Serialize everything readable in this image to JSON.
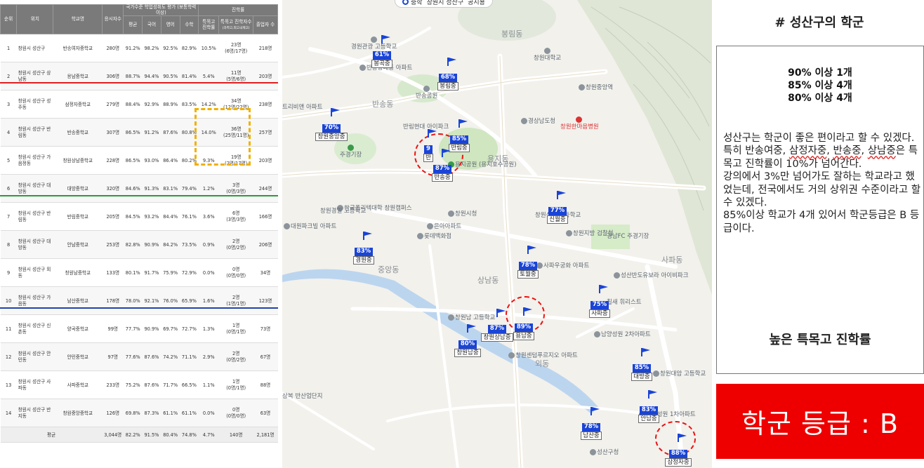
{
  "table": {
    "headers": {
      "rank": "순위",
      "region": "위치",
      "school": "학교명",
      "applicants": "응시자수",
      "achievement_group": "국가수준 학업성취도 평가 (보통학력이상)",
      "avg": "평균",
      "korean": "국어",
      "english": "영어",
      "math": "수학",
      "progress_group": "진학률",
      "special_rate": "특목고 진학률",
      "special_count": "특목고 진학자수",
      "special_count_sub": "(과학고,외고국제고)",
      "graduates": "졸업자 수"
    },
    "rows": [
      {
        "rank": "1",
        "region": "창원시 성산구",
        "school": "반송여자중학교",
        "applicants": "280명",
        "avg": "91.2%",
        "korean": "98.2%",
        "english": "92.5%",
        "math": "82.9%",
        "special_rate": "10.5%",
        "special_count": "23명\n(6명/17명)",
        "graduates": "218명"
      },
      {
        "rank": "2",
        "region": "창원시 성산구 상남동",
        "school": "용남중학교",
        "applicants": "306명",
        "avg": "88.7%",
        "korean": "94.4%",
        "english": "90.5%",
        "math": "81.4%",
        "special_rate": "5.4%",
        "special_count": "11명\n(5명/6명)",
        "graduates": "203명"
      },
      {
        "rank": "3",
        "region": "창원시 성산구 성주동",
        "school": "삼정자중학교",
        "applicants": "279명",
        "avg": "88.4%",
        "korean": "92.9%",
        "english": "88.9%",
        "math": "83.5%",
        "special_rate": "14.2%",
        "special_count": "34명\n(12명/22명)",
        "graduates": "238명"
      },
      {
        "rank": "4",
        "region": "창원시 성산구 반림동",
        "school": "반송중학교",
        "applicants": "307명",
        "avg": "86.5%",
        "korean": "91.2%",
        "english": "87.6%",
        "math": "80.8%",
        "special_rate": "14.0%",
        "special_count": "36명\n(25명/11명)",
        "graduates": "257명"
      },
      {
        "rank": "5",
        "region": "창원시 성산구 가음정동",
        "school": "창원상남중학교",
        "applicants": "228명",
        "avg": "86.5%",
        "korean": "93.0%",
        "english": "86.4%",
        "math": "80.2%",
        "special_rate": "9.3%",
        "special_count": "19명\n(2명/17명)",
        "graduates": "203명"
      },
      {
        "rank": "6",
        "region": "창원시 성산구 대방동",
        "school": "대방중학교",
        "applicants": "320명",
        "avg": "84.6%",
        "korean": "91.3%",
        "english": "83.1%",
        "math": "79.4%",
        "special_rate": "1.2%",
        "special_count": "3명\n(0명/3명)",
        "graduates": "244명"
      },
      {
        "rank": "7",
        "region": "창원시 성산구 반림동",
        "school": "반림중학교",
        "applicants": "205명",
        "avg": "84.5%",
        "korean": "93.2%",
        "english": "84.4%",
        "math": "76.1%",
        "special_rate": "3.6%",
        "special_count": "6명\n(3명/3명)",
        "graduates": "166명"
      },
      {
        "rank": "8",
        "region": "창원시 성산구 대방동",
        "school": "안남중학교",
        "applicants": "253명",
        "avg": "82.8%",
        "korean": "90.9%",
        "english": "84.2%",
        "math": "73.5%",
        "special_rate": "0.9%",
        "special_count": "2명\n(0명/2명)",
        "graduates": "206명"
      },
      {
        "rank": "9",
        "region": "창원시 성산구 외동",
        "school": "창원남중학교",
        "applicants": "133명",
        "avg": "80.1%",
        "korean": "91.7%",
        "english": "75.9%",
        "math": "72.9%",
        "special_rate": "0.0%",
        "special_count": "0명\n(0명/0명)",
        "graduates": "34명"
      },
      {
        "rank": "10",
        "region": "창원시 성산구 가음동",
        "school": "남산중학교",
        "applicants": "178명",
        "avg": "78.0%",
        "korean": "92.1%",
        "english": "76.0%",
        "math": "65.9%",
        "special_rate": "1.6%",
        "special_count": "2명\n(1명/1명)",
        "graduates": "123명"
      },
      {
        "rank": "11",
        "region": "창원시 성산구 신촌동",
        "school": "양곡중학교",
        "applicants": "99명",
        "avg": "77.7%",
        "korean": "90.9%",
        "english": "69.7%",
        "math": "72.7%",
        "special_rate": "1.3%",
        "special_count": "1명\n(0명/1명)",
        "graduates": "73명"
      },
      {
        "rank": "12",
        "region": "창원시 성산구 안민동",
        "school": "안민중학교",
        "applicants": "97명",
        "avg": "77.6%",
        "korean": "87.6%",
        "english": "74.2%",
        "math": "71.1%",
        "special_rate": "2.9%",
        "special_count": "2명\n(0명/2명)",
        "graduates": "67명"
      },
      {
        "rank": "13",
        "region": "창원시 성산구 사파동",
        "school": "사파중학교",
        "applicants": "233명",
        "avg": "75.2%",
        "korean": "87.6%",
        "english": "71.7%",
        "math": "66.5%",
        "special_rate": "1.1%",
        "special_count": "1명\n(0명/1명)",
        "graduates": "88명"
      },
      {
        "rank": "14",
        "region": "창원시 성산구 반지동",
        "school": "창원중앙중학교",
        "applicants": "126명",
        "avg": "69.8%",
        "korean": "87.3%",
        "english": "61.1%",
        "math": "61.1%",
        "special_rate": "0.0%",
        "special_count": "0명\n(0명/0명)",
        "graduates": "63명"
      }
    ],
    "average_row": {
      "label": "평균",
      "applicants": "3,044명",
      "avg": "82.2%",
      "korean": "91.5%",
      "english": "80.4%",
      "math": "74.8%",
      "special_rate": "4.7%",
      "special_count": "140명",
      "graduates": "2,181명"
    },
    "separator_colors": [
      "#e02020",
      "#2a9a3a",
      "#2244aa"
    ],
    "highlight_color": "#f0b000"
  },
  "map": {
    "filter_chips": [
      "중학",
      "창원시 성산구",
      "공시용"
    ],
    "flag_color": "#1a44d6",
    "markers": [
      {
        "pct": "61%",
        "name": "봉곡중"
      },
      {
        "pct": "68%",
        "name": "봉림중"
      },
      {
        "pct": "70%",
        "name": "창원중앙중"
      },
      {
        "pct": "85%",
        "name": "반림중"
      },
      {
        "pct": "9",
        "name": "반"
      },
      {
        "pct": "87%",
        "name": "반송중"
      },
      {
        "pct": "77%",
        "name": "신월중"
      },
      {
        "pct": "83%",
        "name": "경원중"
      },
      {
        "pct": "78%",
        "name": "토월중"
      },
      {
        "pct": "75%",
        "name": "사파중"
      },
      {
        "pct": "80%",
        "name": "창원남중"
      },
      {
        "pct": "87%",
        "name": "창원상남중"
      },
      {
        "pct": "89%",
        "name": "용남중"
      },
      {
        "pct": "85%",
        "name": "대방중"
      },
      {
        "pct": "83%",
        "name": "안남중"
      },
      {
        "pct": "78%",
        "name": "남산중"
      },
      {
        "pct": "88%",
        "name": "삼정자중"
      }
    ],
    "districts": [
      "봉림동",
      "반송동",
      "용지동",
      "중앙동",
      "상남동",
      "사파동",
      "외동",
      "성산구청"
    ],
    "pois": [
      "경원관광 고등학교",
      "반송동대동 아파트",
      "창원대학교",
      "창원중앙역",
      "반송공원",
      "트리비앤 아파트",
      "반림현대 아이파크",
      "경상남도청",
      "창원한마음병원",
      "주경기장",
      "용지공원 (용지호수공원)",
      "한국폴리텍대학 창원캠퍼스",
      "창원시청",
      "창원신월 고등학교",
      "창원지방 검찰청",
      "경남FC 주경기장",
      "대원파크빌 아파트",
      "창원경일 고등학교",
      "은아아파트",
      "롯데백화점",
      "사파우궁화 아파트",
      "성산반도유보라 아이비파크",
      "남양성원 2차아파트",
      "창원대암 고등학교",
      "창원센텀푸르지오 아파트",
      "안남성원 1차아파트",
      "상복 반산업단지",
      "창원남 고등학교",
      "칠새 휘리스트"
    ]
  },
  "right": {
    "title": "# 성산구의 학군",
    "stats": [
      "90% 이상 1개",
      "85% 이상 4개",
      "80% 이상 4개"
    ],
    "desc_1": "성산구는 학군이 좋은 편이라고 할 수 있겠다.",
    "desc_2_pre": "특히 반송여중, ",
    "desc_2_u1": "삼정자중",
    "desc_2_mid": ", ",
    "desc_2_u2": "반송중",
    "desc_2_sep": ", ",
    "desc_2_u3": "상남중",
    "desc_2_post": "은 특목고 진학률이 10%가 넘어간다.",
    "desc_3": "강의에서 3%만 넘어가도 잘하는 학교라고 했었는데, 전국에서도 거의 상위권 수준이라고 할 수 있겠다.",
    "desc_4": "85%이상 학교가 4개 있어서 학군등급은 B 등급이다.",
    "subtitle": "높은 특목고 진학률",
    "grade_label": "학군 등급 : B",
    "grade_bg": "#ee0000"
  }
}
